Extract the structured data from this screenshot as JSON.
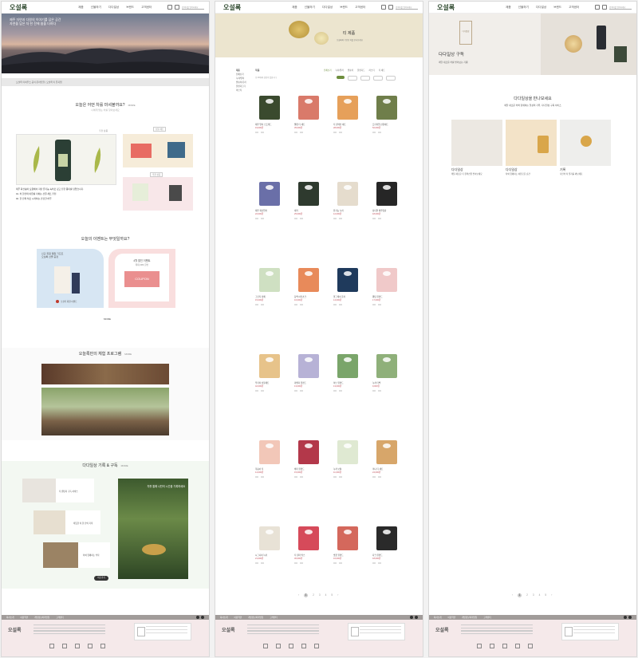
{
  "header": {
    "logo": "오설록",
    "nav": [
      "제품",
      "선물하기",
      "다다일상",
      "브랜드",
      "고객센터"
    ],
    "search_placeholder": "검색어를 입력하세요"
  },
  "colors": {
    "accent": "#6e8e3e",
    "sale": "#c0505a",
    "footer_bg": "#f5e9ea",
    "footer_bar": "#a19c9a"
  },
  "page1": {
    "hero": {
      "line1": "제주 자연과 다원의 이야기를 담은 공간",
      "line2": "자연을 담은 차 한 잔에 쉼을 더하다"
    },
    "info_strip": "오설록 티하우스 공식 온라인몰 | 오설록 티 뮤지엄",
    "sec1": {
      "title": "오늘은 어떤 차를 마셔볼까요?",
      "subtitle": "나에게 맞는 차를 찾아보세요",
      "more": "MORE",
      "badge1": "추천 상품",
      "badge2": "선물 세트",
      "desc1": "제주 화산송이 토양에서 자란 유기농 녹차로 깊고 진한 풍미를 담았습니다.",
      "desc2": "01. 차 한잔의 여유를 더하는 선물 세트 추천",
      "desc3": "02. 한 잔의 차로 시작하는 건강한 하루"
    },
    "sec2": {
      "title": "오늘의 이벤트는 무엇일까요?",
      "card1_line1": "신규 회원 웰컴 기프트",
      "card1_line2": "오설록 선물 증정",
      "card1_label": "오설록 회원 이벤트",
      "card2_line1": "4월 할인 이벤트",
      "card2_line2": "최대 20% 할인",
      "coupon": "COUPON",
      "more": "MORE"
    },
    "sec3": {
      "title": "오늘록만의 체험 프로그램",
      "more": "MORE"
    },
    "sec4": {
      "title": "다다일상 기록 & 구독",
      "more": "MORE",
      "card1": "티 캘린더 구독 서비스",
      "card2": "따뜻한 차 한 잔의 기록",
      "card3": "차와 함께하는 식탁",
      "side_text": "차를 통해 나만의 시간을 기록하세요",
      "button": "바로가기"
    }
  },
  "page2": {
    "hero_title": "티 제품",
    "hero_sub": "오설록의 다양한 차를 만나보세요",
    "side": {
      "label": "제품",
      "items": [
        "전체보기",
        "녹차/말차",
        "발효차/홍차",
        "블렌디드티",
        "허브티"
      ]
    },
    "sort_title": "제품",
    "tabs": [
      "전체보기",
      "녹차/말차",
      "발효차",
      "블렌디드",
      "허브티",
      "티 세트"
    ],
    "count_text": "총 48개의 상품이 있습니다",
    "products": [
      {
        "name": "제주 말차 스프레드",
        "price": "19,000원"
      },
      {
        "name": "웰컴 티 세트",
        "price": "35,000원"
      },
      {
        "name": "티 컬렉션 세트",
        "price": "28,000원"
      },
      {
        "name": "프리미엄 선물세트",
        "price": "52,000원"
      },
      {
        "name": "제주 화산암차",
        "price": "22,000원"
      },
      {
        "name": "세작",
        "price": "25,000원"
      },
      {
        "name": "유기농 녹차",
        "price": "12,000원"
      },
      {
        "name": "삼다연 제주영귤",
        "price": "18,000원"
      },
      {
        "name": "그린티 라떼",
        "price": "15,000원"
      },
      {
        "name": "동백 아티초크",
        "price": "16,000원"
      },
      {
        "name": "얼그레이 홍차",
        "price": "14,000원"
      },
      {
        "name": "웨딩 블렌드",
        "price": "17,000원"
      },
      {
        "name": "우리차 선물세트",
        "price": "42,000원"
      },
      {
        "name": "라벤더 블렌드",
        "price": "13,000원"
      },
      {
        "name": "허브 블렌드",
        "price": "13,000원"
      },
      {
        "name": "녹차 티백",
        "price": "9,000원"
      },
      {
        "name": "복숭아 티",
        "price": "14,000원"
      },
      {
        "name": "베리 블렌드",
        "price": "15,000원"
      },
      {
        "name": "녹차 보틀",
        "price": "11,000원"
      },
      {
        "name": "미니 티 세트",
        "price": "24,000원"
      },
      {
        "name": "시그니처 녹차",
        "price": "21,000원"
      },
      {
        "name": "티 컬러 박스",
        "price": "30,000원"
      },
      {
        "name": "벚꽃 블렌드",
        "price": "16,000원"
      },
      {
        "name": "다크 블렌드",
        "price": "18,000원"
      }
    ],
    "pages": [
      "1",
      "2",
      "3",
      "4",
      "5"
    ]
  },
  "page3": {
    "hero_title": "다다일상 구독",
    "hero_sub": "매달 새로운 차를 받아보는 기쁨",
    "hero_label": "다다일상",
    "intro_title": "다다일상을 만나보세요",
    "intro_text": "매달 새로운 차와 함께하는 일상의 기록, 다다일상 구독 서비스",
    "cards": [
      {
        "title": "다다일상",
        "text": "매달 새로운 티 컬렉션을 받아보세요"
      },
      {
        "title": "다다일상",
        "text": "차와 함께하는 여유로운 순간"
      },
      {
        "title": "기록",
        "text": "나만의 차 일기를 써보세요"
      }
    ],
    "pages": [
      "1",
      "2",
      "3",
      "4",
      "5"
    ]
  },
  "footer": {
    "links": [
      "회사소개",
      "이용약관",
      "개인정보처리방침",
      "고객센터"
    ],
    "logo": "오설록"
  }
}
